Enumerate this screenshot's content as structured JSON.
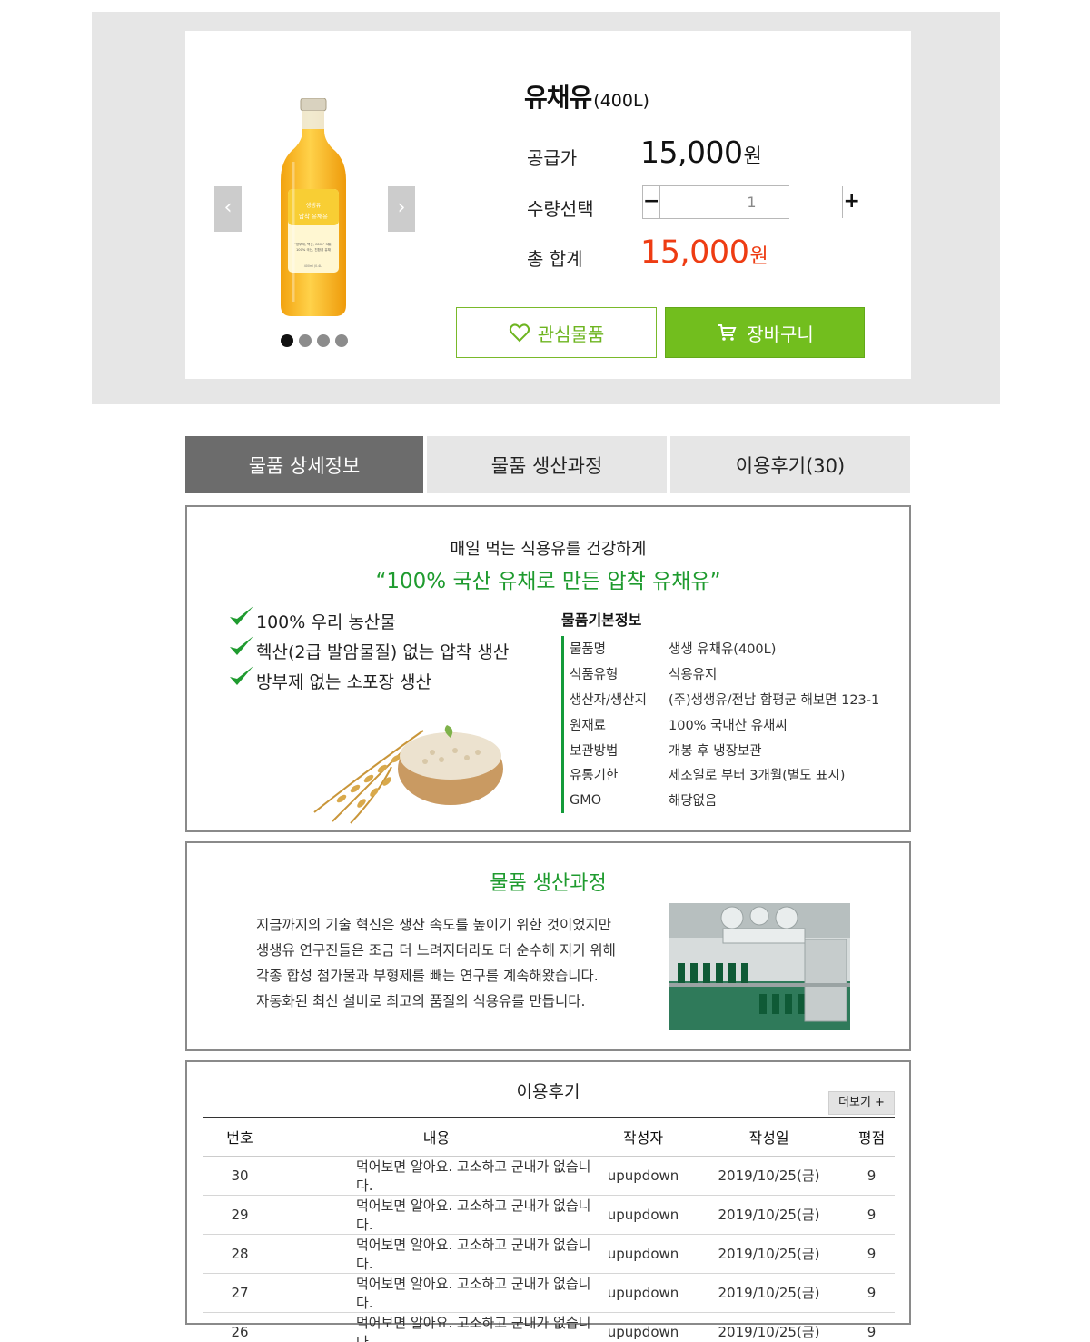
{
  "product": {
    "title": "유채유",
    "volume": "(400L)",
    "price_label": "공급가",
    "price": "15,000",
    "currency": "원",
    "qty_label": "수량선택",
    "qty_value": "1",
    "qty_minus": "−",
    "qty_plus": "+",
    "total_label": "총 합계",
    "total": "15,000",
    "wish_label": "관심물품",
    "cart_label": "장바구니",
    "prev_arrow": "‹",
    "next_arrow": "›",
    "bottle_brand": "생생유",
    "bottle_name": "압착 유채유",
    "bottle_copy1": "\"방부제, 헥산, GMO\" 3無!",
    "bottle_copy2": "100% 국산, 친환경 유채",
    "bottle_volume": "400ml (0.4L)",
    "carousel_dots": 4
  },
  "tabs": [
    "물품 상세정보",
    "물품 생산과정",
    "이용후기(30)"
  ],
  "detail": {
    "subtitle": "매일 먹는 식용유를 건강하게",
    "headline": "“100% 국산 유채로 만든 압착 유채유”",
    "checks": [
      "100% 우리 농산물",
      "헥산(2급 발암물질) 없는 압착 생산",
      "방부제 없는 소포장 생산"
    ],
    "spec_title": "물품기본정보",
    "spec": [
      {
        "k": "물품명",
        "v": "생생 유채유(400L)"
      },
      {
        "k": "식품유형",
        "v": "식용유지"
      },
      {
        "k": "생산자/생산지",
        "v": "(주)생생유/전남 함평군 해보면 123-1"
      },
      {
        "k": "원재료",
        "v": "100% 국내산 유채씨"
      },
      {
        "k": "보관방법",
        "v": "개봉 후 냉장보관"
      },
      {
        "k": "유통기한",
        "v": "제조일로 부터 3개월(별도 표시)"
      },
      {
        "k": "GMO",
        "v": "해당없음"
      }
    ]
  },
  "process": {
    "title": "물품 생산과정",
    "lines": [
      "지금까지의 기술 혁신은 생산 속도를 높이기 위한 것이었지만",
      "생생유 연구진들은 조금 더 느려지더라도 더 순수해 지기 위해",
      "각종 합성 첨가물과 부형제를 빼는 연구를 계속해왔습니다.",
      "자동화된 최신 설비로 최고의 품질의 식용유를 만듭니다."
    ]
  },
  "reviews": {
    "title": "이용후기",
    "more_label": "더보기 +",
    "headers": [
      "번호",
      "내용",
      "작성자",
      "작성일",
      "평점"
    ],
    "rows": [
      [
        "30",
        "먹어보면 알아요. 고소하고 군내가 없습니다.",
        "upupdown",
        "2019/10/25(금)",
        "9"
      ],
      [
        "29",
        "먹어보면 알아요. 고소하고 군내가 없습니다.",
        "upupdown",
        "2019/10/25(금)",
        "9"
      ],
      [
        "28",
        "먹어보면 알아요. 고소하고 군내가 없습니다.",
        "upupdown",
        "2019/10/25(금)",
        "9"
      ],
      [
        "27",
        "먹어보면 알아요. 고소하고 군내가 없습니다.",
        "upupdown",
        "2019/10/25(금)",
        "9"
      ],
      [
        "26",
        "먹어보면 알아요. 고소하고 군내가 없습니다.",
        "upupdown",
        "2019/10/25(금)",
        "9"
      ]
    ]
  },
  "colors": {
    "accent_green": "#72be1e",
    "heading_green": "#1f9b2f",
    "price_red": "#ee3c13",
    "active_tab": "#6c6c6c"
  }
}
